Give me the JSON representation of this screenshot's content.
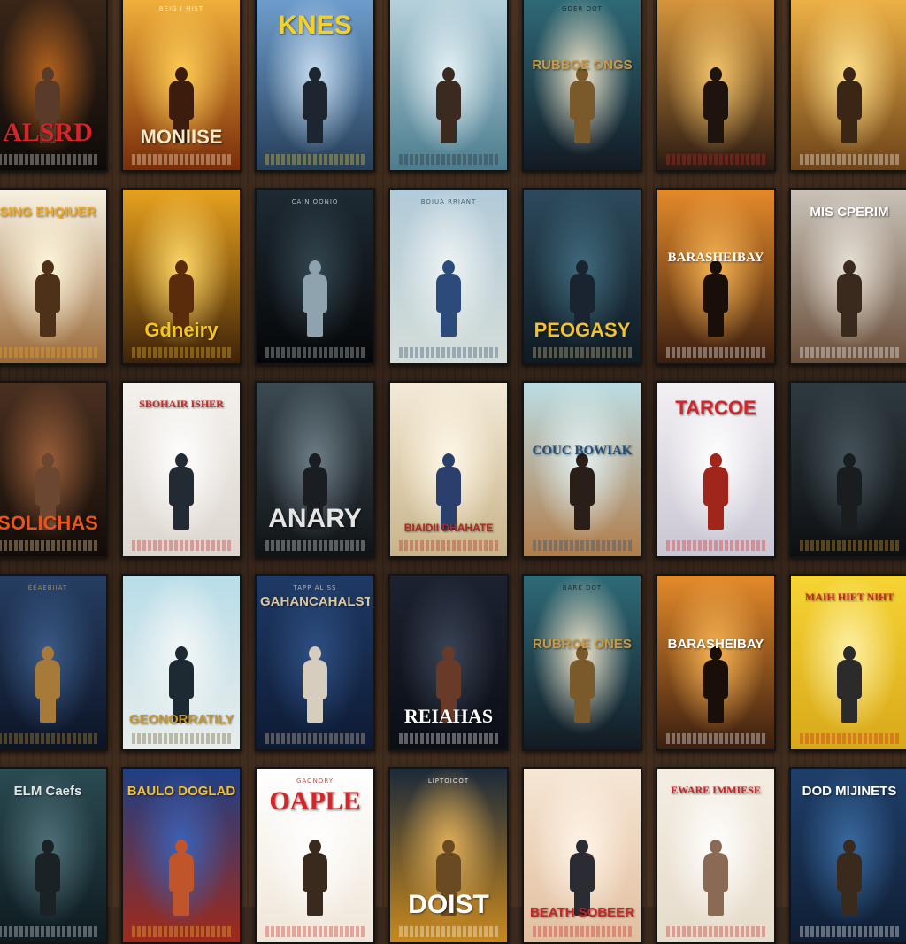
{
  "posters": [
    {
      "title": "ALSRD",
      "tagline": "",
      "bg": [
        "#3a2618",
        "#0e0a08"
      ],
      "accent": "#d4262a",
      "ink": "#e9e4de",
      "title_at": "bottom",
      "figure": "#5a3a28",
      "glow": "#b6631f"
    },
    {
      "title": "MONIISE",
      "tagline": "BEIG I HIST",
      "bg": [
        "#f2b23b",
        "#7a2d0a"
      ],
      "accent": "#f7e8c8",
      "ink": "#fff4dd",
      "title_at": "bottom",
      "figure": "#3c1d0d",
      "glow": "#ffcc55"
    },
    {
      "title": "KNES",
      "tagline": "",
      "bg": [
        "#6f9fcf",
        "#263e58"
      ],
      "accent": "#f3d12b",
      "ink": "#f3d12b",
      "title_at": "top",
      "figure": "#1d2630",
      "glow": "#c9dff2"
    },
    {
      "title": "",
      "tagline": "",
      "bg": [
        "#b8d3de",
        "#4c7d8e"
      ],
      "accent": "#2b2b2b",
      "ink": "#2b2b2b",
      "title_at": "top",
      "figure": "#3b2a20",
      "glow": "#e6f2f6"
    },
    {
      "title": "RUBBOE ONGS",
      "tagline": "GOER OOT",
      "bg": [
        "#2f6b78",
        "#121a24"
      ],
      "accent": "#c89a45",
      "ink": "#1c1c1c",
      "title_at": "middle",
      "figure": "#7a5a2a",
      "glow": "#f1e6cc"
    },
    {
      "title": "",
      "tagline": "",
      "bg": [
        "#d8973d",
        "#2a1a12"
      ],
      "accent": "#c92525",
      "ink": "#c92525",
      "title_at": "top",
      "figure": "#1e140d",
      "glow": "#f4c56a"
    },
    {
      "title": "",
      "tagline": "",
      "bg": [
        "#f0b347",
        "#6d4319"
      ],
      "accent": "#ffffff",
      "ink": "#ffffff",
      "title_at": "top",
      "figure": "#3b2615",
      "glow": "#ffe08a"
    },
    {
      "title": "SING EHQIUER",
      "tagline": "",
      "bg": [
        "#f7f1e1",
        "#9a6a3a"
      ],
      "accent": "#f2a91f",
      "ink": "#f2a91f",
      "title_at": "top",
      "figure": "#4d3119",
      "glow": "#fff6dd"
    },
    {
      "title": "Gdneiry",
      "tagline": "",
      "bg": [
        "#e7a11e",
        "#3e2208"
      ],
      "accent": "#f4c61a",
      "ink": "#f4c61a",
      "title_at": "bottom",
      "figure": "#5a2c0b",
      "glow": "#ffd86a"
    },
    {
      "title": "",
      "tagline": "CAINIOONIO",
      "bg": [
        "#1e2a33",
        "#050607"
      ],
      "accent": "#c8d4dd",
      "ink": "#c8d4dd",
      "title_at": "top",
      "figure": "#8fa3ae",
      "glow": "#33454f"
    },
    {
      "title": "",
      "tagline": "BOIUA RRIANT",
      "bg": [
        "#b2cbd9",
        "#d4ddd9"
      ],
      "accent": "#2f4a6b",
      "ink": "#2f4a6b",
      "title_at": "top",
      "figure": "#2c4b7a",
      "glow": "#eef3f4"
    },
    {
      "title": "PEOGASY",
      "tagline": "",
      "bg": [
        "#2d4a5c",
        "#0f1a22"
      ],
      "accent": "#f2c230",
      "ink": "#d8c68f",
      "title_at": "bottom",
      "figure": "#1a2430",
      "glow": "#3f6a7c"
    },
    {
      "title": "BARASHEIBAY",
      "tagline": "",
      "bg": [
        "#e48a2a",
        "#3a1e10"
      ],
      "accent": "#ffffff",
      "ink": "#ffffff",
      "title_at": "middle",
      "figure": "#1a0f08",
      "glow": "#f7b453"
    },
    {
      "title": "MIS CPERIM",
      "tagline": "",
      "bg": [
        "#c9c2b8",
        "#6a4f3a"
      ],
      "accent": "#ffffff",
      "ink": "#ffffff",
      "title_at": "top",
      "figure": "#3a2a1e",
      "glow": "#e8e2d8"
    },
    {
      "title": "SOLICHAS",
      "tagline": "",
      "bg": [
        "#4a3020",
        "#120b07"
      ],
      "accent": "#e9541b",
      "ink": "#f1d9a6",
      "title_at": "bottom",
      "figure": "#6b4630",
      "glow": "#9a5f3a"
    },
    {
      "title": "SBOHAIR ISHER",
      "tagline": "",
      "bg": [
        "#f4f1ec",
        "#dcd6cf"
      ],
      "accent": "#c92a2a",
      "ink": "#c92a2a",
      "title_at": "top",
      "figure": "#222a33",
      "glow": "#ffffff"
    },
    {
      "title": "ANARY",
      "tagline": "",
      "bg": [
        "#3c4a52",
        "#0f1316"
      ],
      "accent": "#e5e5e5",
      "ink": "#e5e5e5",
      "title_at": "bottom",
      "figure": "#1a1e22",
      "glow": "#6f7f88"
    },
    {
      "title": "BIAIDII DHAHATE",
      "tagline": "",
      "bg": [
        "#f3ead7",
        "#c9b48a"
      ],
      "accent": "#b4281f",
      "ink": "#b4281f",
      "title_at": "bottom",
      "figure": "#2a3f6b",
      "glow": "#fff8e8"
    },
    {
      "title": "COUC BOWIAK",
      "tagline": "",
      "bg": [
        "#bcdde4",
        "#b07c4a"
      ],
      "accent": "#1f4f7a",
      "ink": "#1f4f7a",
      "title_at": "middle",
      "figure": "#2a1e18",
      "glow": "#e4f2f4"
    },
    {
      "title": "TARCOE",
      "tagline": "",
      "bg": [
        "#f3f0f4",
        "#c9c6d3"
      ],
      "accent": "#d4262a",
      "ink": "#d4262a",
      "title_at": "top",
      "figure": "#a0261c",
      "glow": "#ffffff"
    },
    {
      "title": "",
      "tagline": "",
      "bg": [
        "#2f3a40",
        "#0c0f12"
      ],
      "accent": "#e0a12a",
      "ink": "#e0a12a",
      "title_at": "bottom",
      "figure": "#1a1d20",
      "glow": "#47545b"
    },
    {
      "title": "",
      "tagline": "EEAEBIIAT",
      "bg": [
        "#263e63",
        "#0c1426"
      ],
      "accent": "#c8962c",
      "ink": "#c8962c",
      "title_at": "top",
      "figure": "#a87a3a",
      "glow": "#3a5a86"
    },
    {
      "title": "GEONORRATILY",
      "tagline": "",
      "bg": [
        "#b9dde8",
        "#e8edec"
      ],
      "accent": "#c8962c",
      "ink": "#6a5a2a",
      "title_at": "bottom",
      "figure": "#1e2a33",
      "glow": "#f4f8f8"
    },
    {
      "title": "GAHANCAHALST",
      "tagline": "TAPP AL SS",
      "bg": [
        "#1f3a66",
        "#0d1a33"
      ],
      "accent": "#d9c7a6",
      "ink": "#d9c7a6",
      "title_at": "top",
      "figure": "#d6cdbf",
      "glow": "#2e4f82"
    },
    {
      "title": "REIAHAS",
      "tagline": "",
      "bg": [
        "#1c2230",
        "#0a0d14"
      ],
      "accent": "#ffffff",
      "ink": "#ffffff",
      "title_at": "bottom",
      "figure": "#6a3a28",
      "glow": "#3a4456"
    },
    {
      "title": "RUBROE ONES",
      "tagline": "BARK DOT",
      "bg": [
        "#2f6b78",
        "#121a24"
      ],
      "accent": "#c89a45",
      "ink": "#1c1c1c",
      "title_at": "middle",
      "figure": "#7a5a2a",
      "glow": "#f1e6cc"
    },
    {
      "title": "BARASHEIBAY",
      "tagline": "",
      "bg": [
        "#e48a2a",
        "#3a1e10"
      ],
      "accent": "#ffffff",
      "ink": "#ffffff",
      "title_at": "middle",
      "figure": "#1a0f08",
      "glow": "#f7b453"
    },
    {
      "title": "MAIH HIET NIHT",
      "tagline": "",
      "bg": [
        "#f6d433",
        "#d8a81a"
      ],
      "accent": "#c92525",
      "ink": "#c92525",
      "title_at": "top",
      "figure": "#2b2b2b",
      "glow": "#fff2a8"
    },
    {
      "title": "ELM Caefs",
      "tagline": "",
      "bg": [
        "#2b4a52",
        "#0d1a1e"
      ],
      "accent": "#dfe7e9",
      "ink": "#dfe7e9",
      "title_at": "top",
      "figure": "#1a2226",
      "glow": "#4f7078"
    },
    {
      "title": "BAULO DOGLAD",
      "tagline": "",
      "bg": [
        "#1f3f85",
        "#a02a1a"
      ],
      "accent": "#f2c230",
      "ink": "#f2c230",
      "title_at": "top",
      "figure": "#c0542a",
      "glow": "#3a62b8"
    },
    {
      "title": "OAPLE",
      "tagline": "GAONORY",
      "bg": [
        "#ffffff",
        "#f0e6d8"
      ],
      "accent": "#d4262a",
      "ink": "#d4262a",
      "title_at": "top",
      "figure": "#3a2a1e",
      "glow": "#ffffff"
    },
    {
      "title": "DOIST",
      "tagline": "LIPTOIOOT",
      "bg": [
        "#1c2a3a",
        "#c8891e"
      ],
      "accent": "#ffffff",
      "ink": "#ffffff",
      "title_at": "bottom",
      "figure": "#6a4a22",
      "glow": "#e2b05a"
    },
    {
      "title": "BEATH SOBEER",
      "tagline": "",
      "bg": [
        "#f6e6d4",
        "#e2bfa0"
      ],
      "accent": "#c92525",
      "ink": "#c92525",
      "title_at": "bottom",
      "figure": "#2b2b33",
      "glow": "#fff4e8"
    },
    {
      "title": "EWARE IMMIESE",
      "tagline": "",
      "bg": [
        "#f4ede2",
        "#e6dccb"
      ],
      "accent": "#c92525",
      "ink": "#c92525",
      "title_at": "top",
      "figure": "#8a6a55",
      "glow": "#ffffff"
    },
    {
      "title": "DOD MIJINETS",
      "tagline": "",
      "bg": [
        "#1f3f6b",
        "#0f1e33"
      ],
      "accent": "#ffffff",
      "ink": "#ffffff",
      "title_at": "top",
      "figure": "#3a2a1e",
      "glow": "#3a6aa0"
    }
  ]
}
